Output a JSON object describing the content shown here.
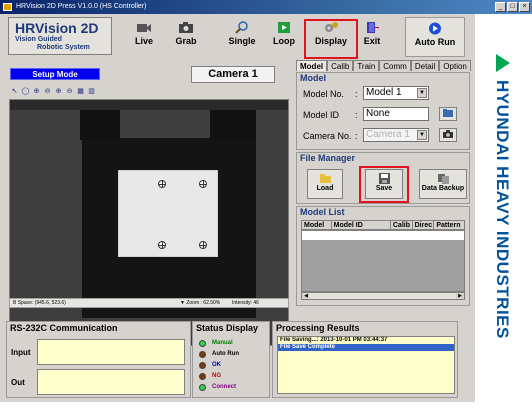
{
  "window": {
    "title": "HRVision 2D Press V1.0.0 (HS Controller)",
    "controls": [
      "_",
      "□",
      "×"
    ]
  },
  "logo": {
    "title": "HRVision 2D",
    "line1": "Vision Guided",
    "line2": "Robotic System"
  },
  "toolbar": {
    "buttons": [
      {
        "label": "Live",
        "icon": "video-camera-icon"
      },
      {
        "label": "Grab",
        "icon": "camera-icon"
      },
      {
        "label": "Single",
        "icon": "magnifier-icon"
      },
      {
        "label": "Loop",
        "icon": "loop-arrow-icon"
      },
      {
        "label": "Display",
        "icon": "display-settings-icon"
      },
      {
        "label": "Exit",
        "icon": "exit-door-icon"
      },
      {
        "label": "Auto Run",
        "icon": "play-icon"
      }
    ]
  },
  "brand": {
    "text": "HYUNDAI HEAVY INDUSTRIES",
    "color": "#00529b",
    "mark_color": "#00a650"
  },
  "main": {
    "mode_label": "Setup Mode",
    "camera_label": "Camera 1",
    "mini_tools": [
      "↖",
      "◯",
      "⊕",
      "⊖",
      "⊕",
      "⊖",
      "▦",
      "▥"
    ],
    "status": {
      "space": "B Space: (945.6, 523.6)",
      "zoom": "▼ Zoom : 62.50%",
      "intensity": "Intensity: 46"
    }
  },
  "right_panel": {
    "tabs": [
      "Model",
      "Calib",
      "Train",
      "Comm",
      "Detail",
      "Option"
    ],
    "model_group": {
      "title": "Model",
      "model_no_label": "Model No.",
      "model_no_value": "Model 1",
      "model_id_label": "Model ID",
      "model_id_value": "None",
      "camera_no_label": "Camera No.",
      "camera_no_value": "Camera 1",
      "sep": ":"
    },
    "file_manager": {
      "title": "File Manager",
      "buttons": [
        {
          "label": "Load",
          "icon": "folder-open-icon"
        },
        {
          "label": "Save",
          "icon": "floppy-disk-icon"
        },
        {
          "label": "Data Backup",
          "icon": "backup-copy-icon"
        }
      ]
    },
    "model_list": {
      "title": "Model List",
      "columns": [
        "Model",
        "Model ID",
        "Calib",
        "Direc",
        "Pattern"
      ]
    }
  },
  "rs232": {
    "title": "RS-232C Communication",
    "input_label": "Input",
    "out_label": "Out"
  },
  "status_display": {
    "title": "Status Display",
    "items": [
      {
        "label": "Manual",
        "led_color": "#2fd14a",
        "text_color": "#008000"
      },
      {
        "label": "Auto Run",
        "led_color": "#7a3a10",
        "text_color": "#000000"
      },
      {
        "label": "OK",
        "led_color": "#7a3a10",
        "text_color": "#0000c0"
      },
      {
        "label": "NG",
        "led_color": "#7a3a10",
        "text_color": "#c00000"
      },
      {
        "label": "Connect",
        "led_color": "#2fd14a",
        "text_color": "#800080"
      }
    ]
  },
  "processing": {
    "title": "Processing Results",
    "lines": [
      {
        "text": "File Saving...: 2013-10-01 PM 03:44:37",
        "selected": false
      },
      {
        "text": "File Save Complete",
        "selected": true
      }
    ]
  }
}
